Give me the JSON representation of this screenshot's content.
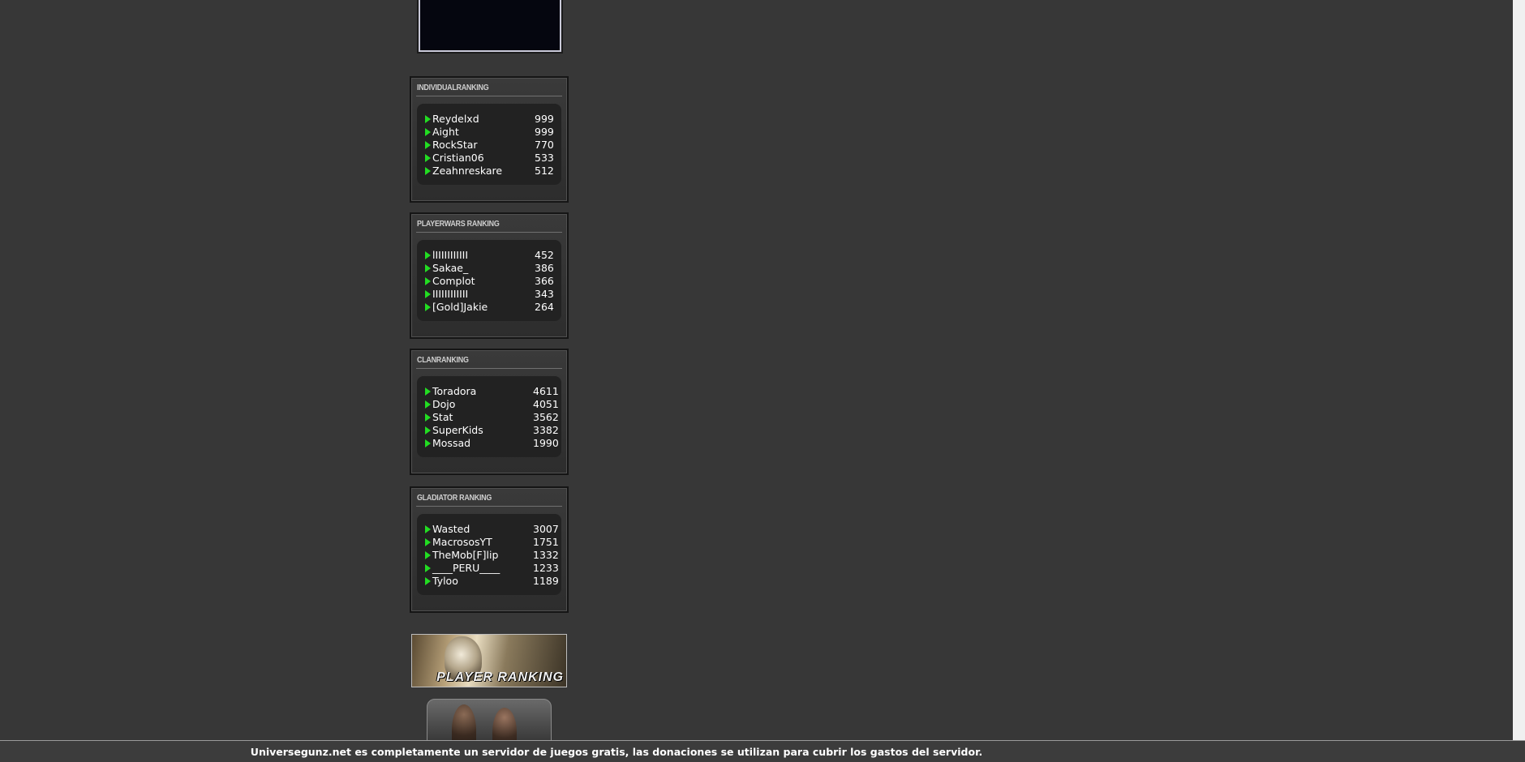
{
  "rankings": {
    "individual": {
      "title": "IndividualRanking",
      "rows": [
        {
          "name": "Reydelxd",
          "score": "999"
        },
        {
          "name": "Aight",
          "score": "999"
        },
        {
          "name": "RockStar",
          "score": "770"
        },
        {
          "name": "Cristian06",
          "score": "533"
        },
        {
          "name": "Zeahnreskare",
          "score": "512"
        }
      ]
    },
    "playerwars": {
      "title": "PlayerWars Ranking",
      "rows": [
        {
          "name": "lIIIIIIIIIII",
          "score": "452"
        },
        {
          "name": "Sakae_",
          "score": "386"
        },
        {
          "name": "Complot",
          "score": "366"
        },
        {
          "name": "IIIIIIIIIIII",
          "score": "343"
        },
        {
          "name": "[Gold]Jakie",
          "score": "264"
        }
      ]
    },
    "clan": {
      "title": "ClanRanking",
      "rows": [
        {
          "name": "Toradora",
          "score": "4611"
        },
        {
          "name": "Dojo",
          "score": "4051"
        },
        {
          "name": "Stat",
          "score": "3562"
        },
        {
          "name": "SuperKids",
          "score": "3382"
        },
        {
          "name": "Mossad",
          "score": "1990"
        }
      ]
    },
    "gladiator": {
      "title": "Gladiator Ranking",
      "rows": [
        {
          "name": "Wasted",
          "score": "3007"
        },
        {
          "name": "MacrososYT",
          "score": "1751"
        },
        {
          "name": "TheMob[F]lip",
          "score": "1332"
        },
        {
          "name": "____PERU____",
          "score": "1233"
        },
        {
          "name": "Tyloo",
          "score": "1189"
        }
      ]
    }
  },
  "banners": {
    "player_ranking_label": "PLAYER RANKING"
  },
  "footer": {
    "text": "Universegunz.net es completamente un servidor de juegos gratis, las donaciones se utilizan para cubrir los gastos del servidor."
  },
  "colors": {
    "background": "#373737",
    "arrow": "#22dd22",
    "list_bg": "#222222"
  }
}
